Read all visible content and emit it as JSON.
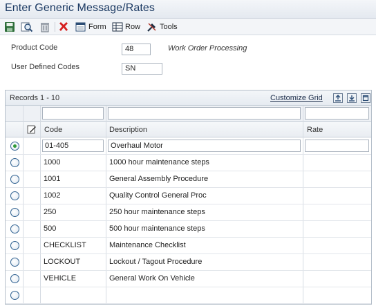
{
  "window": {
    "title": "Enter Generic Message/Rates"
  },
  "toolbar": {
    "form_label": "Form",
    "row_label": "Row",
    "tools_label": "Tools"
  },
  "header": {
    "product_code_label": "Product Code",
    "product_code_value": "48",
    "product_code_desc": "Work Order Processing",
    "udc_label": "User Defined Codes",
    "udc_value": "SN"
  },
  "grid": {
    "records_label": "Records 1 - 10",
    "customize_label": "Customize Grid",
    "columns": {
      "code": "Code",
      "description": "Description",
      "rate": "Rate"
    },
    "rows": [
      {
        "code": "01-405",
        "description": "Overhaul Motor",
        "rate": "",
        "selected": true
      },
      {
        "code": "1000",
        "description": "1000 hour maintenance steps",
        "rate": ""
      },
      {
        "code": "1001",
        "description": "General Assembly Procedure",
        "rate": ""
      },
      {
        "code": "1002",
        "description": "Quality Control General Proc",
        "rate": ""
      },
      {
        "code": "250",
        "description": "250 hour maintenance steps",
        "rate": ""
      },
      {
        "code": "500",
        "description": "500 hour maintenance steps",
        "rate": ""
      },
      {
        "code": "CHECKLIST",
        "description": "Maintenance Checklist",
        "rate": ""
      },
      {
        "code": "LOCKOUT",
        "description": "Lockout / Tagout Procedure",
        "rate": ""
      },
      {
        "code": "VEHICLE",
        "description": "General Work On Vehicle",
        "rate": ""
      },
      {
        "code": "",
        "description": "",
        "rate": ""
      }
    ]
  }
}
